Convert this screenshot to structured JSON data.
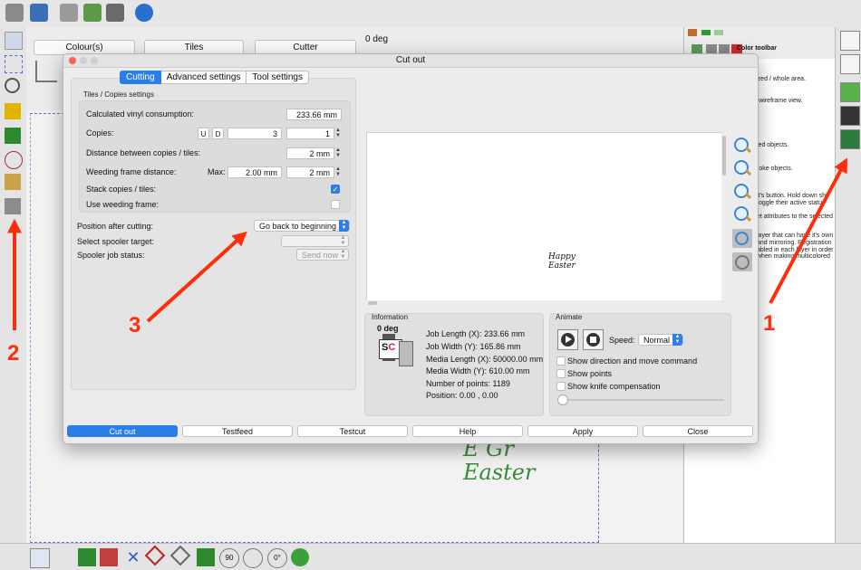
{
  "app": {
    "top_panel": {
      "colours_label": "Colour(s)",
      "tiles_label": "Tiles",
      "cutter_label": "Cutter",
      "deg_label": "0 deg"
    },
    "color_panel": {
      "title": "Color toolbar",
      "lines": [
        "optimized / whole area.",
        "filled / wireframe view.",
        "led objects.",
        "roke objects.",
        "it's button. Hold down shi",
        "toggle their active status",
        "et attributes to the selected",
        "layer that can have it's own",
        "and mirroring. Registration",
        "abled in each layer in order",
        "when making multicolored"
      ]
    },
    "bottom_toolbar": {
      "rot_90": "90",
      "rot_0": "0°"
    }
  },
  "dialog": {
    "title": "Cut out",
    "tabs": [
      {
        "label": "Cutting",
        "active": true
      },
      {
        "label": "Advanced settings",
        "active": false
      },
      {
        "label": "Tool settings",
        "active": false
      }
    ],
    "group_title": "Tiles / Copies settings",
    "rows": {
      "vinyl_label": "Calculated vinyl consumption:",
      "vinyl_value": "233.66 mm",
      "copies_label": "Copies:",
      "u_label": "U",
      "d_label": "D",
      "copies_value_a": "3",
      "copies_value_b": "1",
      "distance_label": "Distance between copies / tiles:",
      "distance_value": "2 mm",
      "weeding_distance_label": "Weeding frame distance:",
      "max_label": "Max:",
      "max_value": "2.00 mm",
      "weeding_value": "2 mm",
      "stack_label": "Stack copies / tiles:",
      "use_weeding_label": "Use weeding frame:"
    },
    "lower": {
      "position_label": "Position after cutting:",
      "position_value": "Go back to beginning",
      "spooler_target_label": "Select spooler target:",
      "spooler_status_label": "Spooler job status:",
      "send_now_label": "Send now"
    },
    "preview_art": [
      "Happy",
      "Easter"
    ],
    "information": {
      "title": "Information",
      "deg": "0 deg",
      "lines": [
        "Job Length (X): 233.66 mm",
        "Job Width (Y): 165.86 mm",
        "Media Length (X): 50000.00 mm",
        "Media Width (Y): 610.00 mm",
        "Number of points: 1189",
        "Position: 0.00 , 0.00"
      ]
    },
    "animate": {
      "title": "Animate",
      "speed_label": "Speed:",
      "speed_value": "Normal",
      "options": [
        "Show direction and move command",
        "Show points",
        "Show knife compensation"
      ]
    },
    "buttons": [
      "Cut out",
      "Testfeed",
      "Testcut",
      "Help",
      "Apply",
      "Close"
    ]
  },
  "background_art": [
    "E  Gr",
    "Easter"
  ],
  "annotations": [
    "1",
    "2",
    "3"
  ],
  "colors": {
    "accent": "#2a7ee8",
    "annotation": "#ff2d0a"
  }
}
